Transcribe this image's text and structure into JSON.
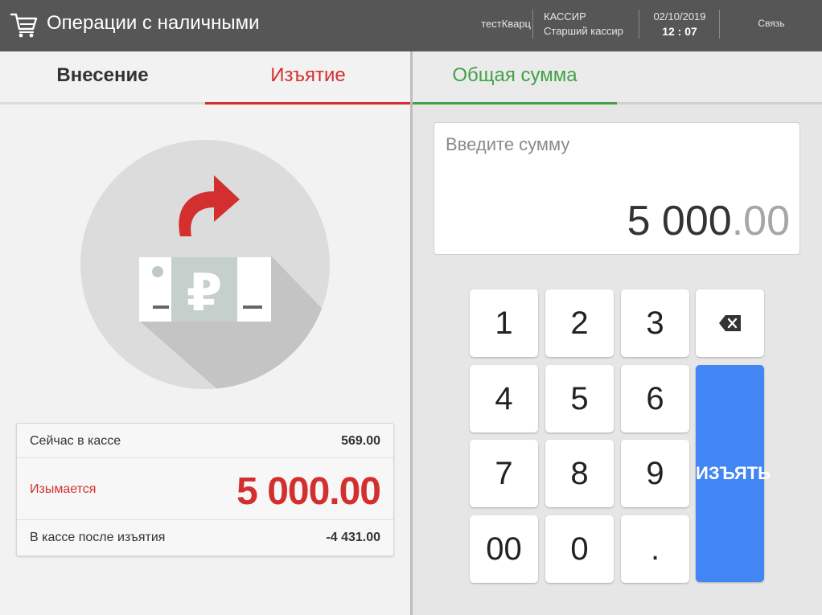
{
  "header": {
    "title": "Операции с наличными",
    "user": "тестКварц",
    "role_title": "КАССИР",
    "role_name": "Старший кассир",
    "date": "02/10/2019",
    "time": "12 : 07",
    "connection_label": "Связь",
    "icon": "cart-icon"
  },
  "left_tabs": {
    "deposit": "Внесение",
    "withdraw": "Изъятие"
  },
  "illustration": {
    "icons": [
      "arrow-icon",
      "ruble-banknote-icon"
    ],
    "currency_symbol": "₽"
  },
  "summary": {
    "current_label": "Сейчас в кассе",
    "current_value": "569.00",
    "withdrawing_label": "Изымается",
    "withdrawing_value": "5 000.00",
    "after_label": "В кассе после изъятия",
    "after_value": "-4 431.00"
  },
  "right_tabs": {
    "total": "Общая сумма"
  },
  "amount": {
    "placeholder": "Введите сумму",
    "integer": "5 000",
    "decimals": ".00"
  },
  "keypad": {
    "k1": "1",
    "k2": "2",
    "k3": "3",
    "k4": "4",
    "k5": "5",
    "k6": "6",
    "k7": "7",
    "k8": "8",
    "k9": "9",
    "k00": "00",
    "k0": "0",
    "kdot": ".",
    "backspace_icon": "backspace-icon",
    "action": "ИЗЪЯТЬ"
  },
  "colors": {
    "header_bg": "#565656",
    "withdraw_red": "#d32f2f",
    "total_green": "#43a047",
    "action_blue": "#4285f4"
  }
}
